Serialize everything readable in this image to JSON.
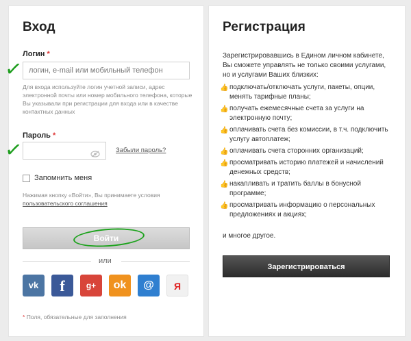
{
  "login": {
    "title": "Вход",
    "login_label": "Логин",
    "required_mark": "*",
    "login_placeholder": "логин, e-mail или мобильный телефон",
    "login_hint": "Для входа используйте логин учетной записи, адрес электронной почты или номер мобильного телефона, которые Вы указывали при регистрации для входа или в качестве контактных данных",
    "password_label": "Пароль",
    "eye_icon": "eye-icon",
    "forgot_password": "Забыли пароль?",
    "remember_me": "Запомнить меня",
    "terms_text": "Нажимая кнопку «Войти», Вы принимаете условия",
    "terms_link": "пользовательского соглашения",
    "submit": "Войти",
    "or": "или",
    "social": {
      "vk": "vk",
      "fb": "f",
      "gplus": "g+",
      "ok": "ok",
      "mail": "@",
      "ya": "Я"
    },
    "required_note": "Поля, обязательные для заполнения"
  },
  "register": {
    "title": "Регистрация",
    "intro": "Зарегистрировавшись в Едином личном кабинете, Вы сможете управлять не только своими услугами, но и услугами Ваших близких:",
    "benefits": [
      "подключать/отключать услуги, пакеты, опции, менять тарифные планы;",
      "получать ежемесячные счета за услуги на электронную почту;",
      "оплачивать счета без комиссии, в т.ч. подключить услугу автоплатеж;",
      "оплачивать счета сторонних организаций;",
      "просматривать историю платежей и начислений денежных средств;",
      "накапливать и тратить баллы в бонусной программе;",
      "просматривать информацию о персональных предложениях и акциях;"
    ],
    "outro": "и многое другое.",
    "button": "Зарегистрироваться"
  },
  "colors": {
    "checkmark_annotation": "#1e9e1e",
    "required": "#dd3333",
    "register_button": "#333333"
  }
}
